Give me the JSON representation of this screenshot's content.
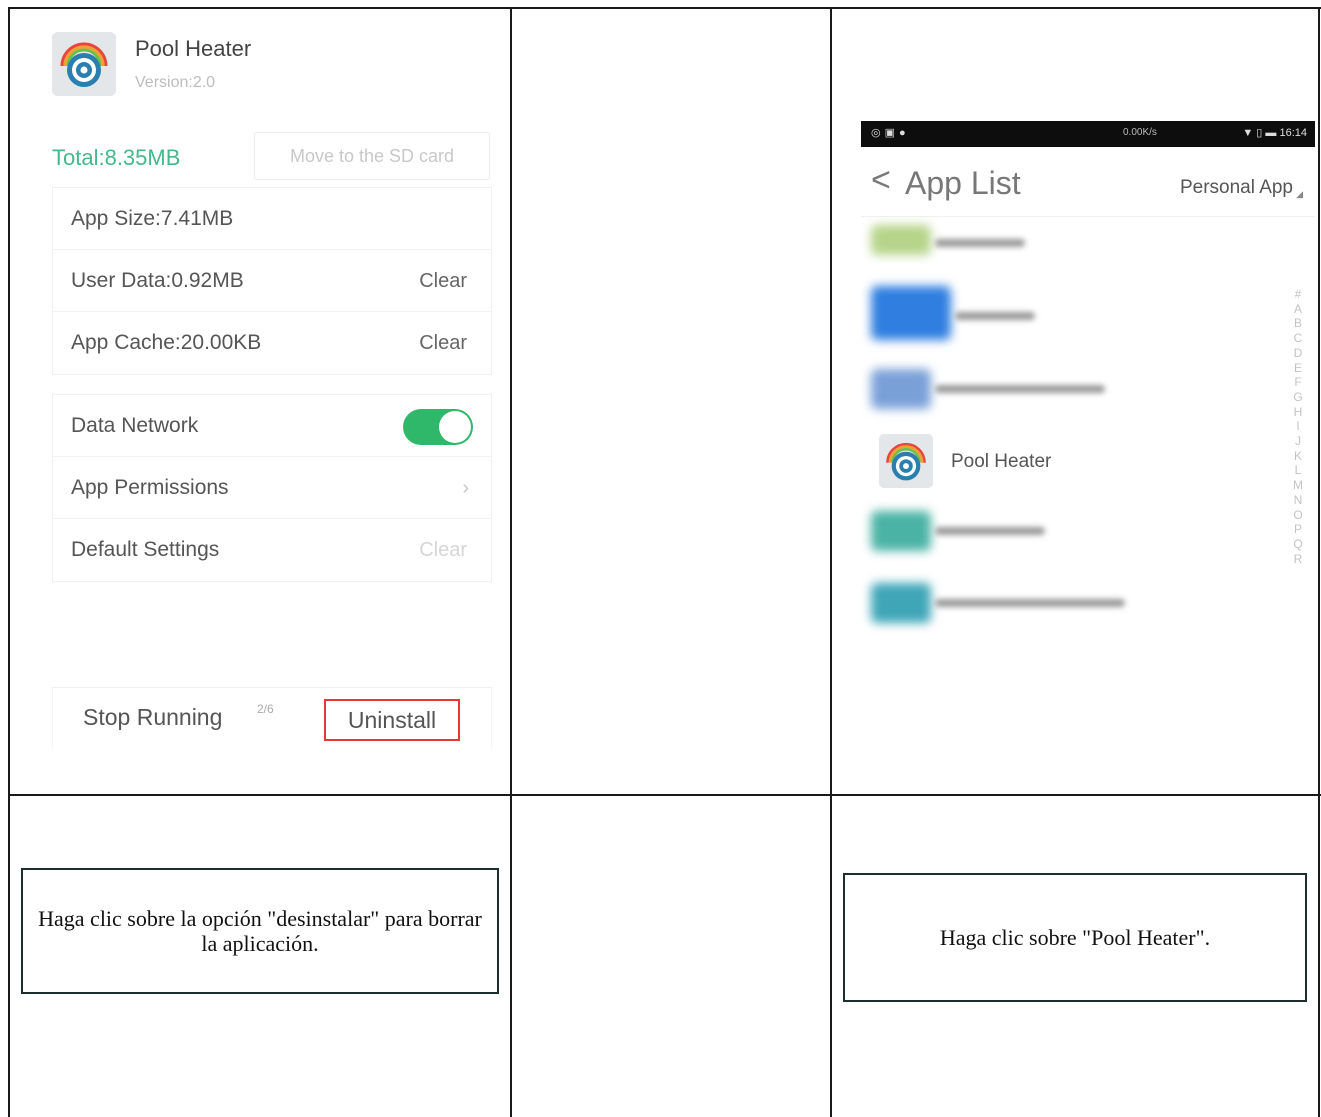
{
  "app_details": {
    "app_name": "Pool Heater",
    "version": "Version:2.0",
    "total": "Total:8.35MB",
    "move_sd_label": "Move to the SD card",
    "storage_rows": [
      {
        "label": "App Size:7.41MB",
        "action": ""
      },
      {
        "label": "User Data:0.92MB",
        "action": "Clear"
      },
      {
        "label": "App Cache:20.00KB",
        "action": "Clear"
      }
    ],
    "settings_rows": [
      {
        "label": "Data Network",
        "toggle_on": true
      },
      {
        "label": "App Permissions",
        "chevron": "›"
      },
      {
        "label": "Default Settings",
        "action": "Clear",
        "action_disabled": true
      }
    ],
    "stop_running_label": "Stop Running",
    "page_indicator": "2/6",
    "uninstall_label": "Uninstall",
    "colors": {
      "total": "#45b98a",
      "toggle_on": "#2fb86a",
      "highlight_box": "#e53935"
    }
  },
  "app_list": {
    "status_bar": {
      "left_icons": "◎▣●",
      "speed": "0.00K/s",
      "right_icons": "▼ ▯ ▬ 16:14"
    },
    "back_icon": "<",
    "title": "App List",
    "filter_label": "Personal App",
    "filter_caret": "◢",
    "highlighted_app": "Pool Heater",
    "alphabet": [
      "#",
      "A",
      "B",
      "C",
      "D",
      "E",
      "F",
      "G",
      "H",
      "I",
      "J",
      "K",
      "L",
      "M",
      "N",
      "O",
      "P",
      "Q",
      "R"
    ]
  },
  "instructions": {
    "uninstall_step": "Haga clic sobre la opción \"desinstalar\" para borrar la aplicación.",
    "select_app_step": "Haga clic sobre \"Pool Heater\"."
  }
}
